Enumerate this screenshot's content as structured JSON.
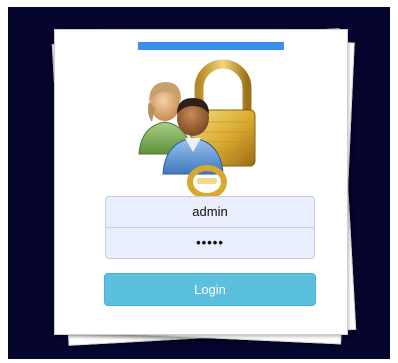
{
  "login": {
    "username_value": "admin",
    "password_value": "•••••",
    "login_label": "Login"
  },
  "colors": {
    "backdrop": "#05052e",
    "top_bar": "#3a8ff2",
    "input_bg": "#e8eefb",
    "button_bg": "#5bc0de"
  },
  "icons": {
    "logo": "users-padlock-icon"
  }
}
